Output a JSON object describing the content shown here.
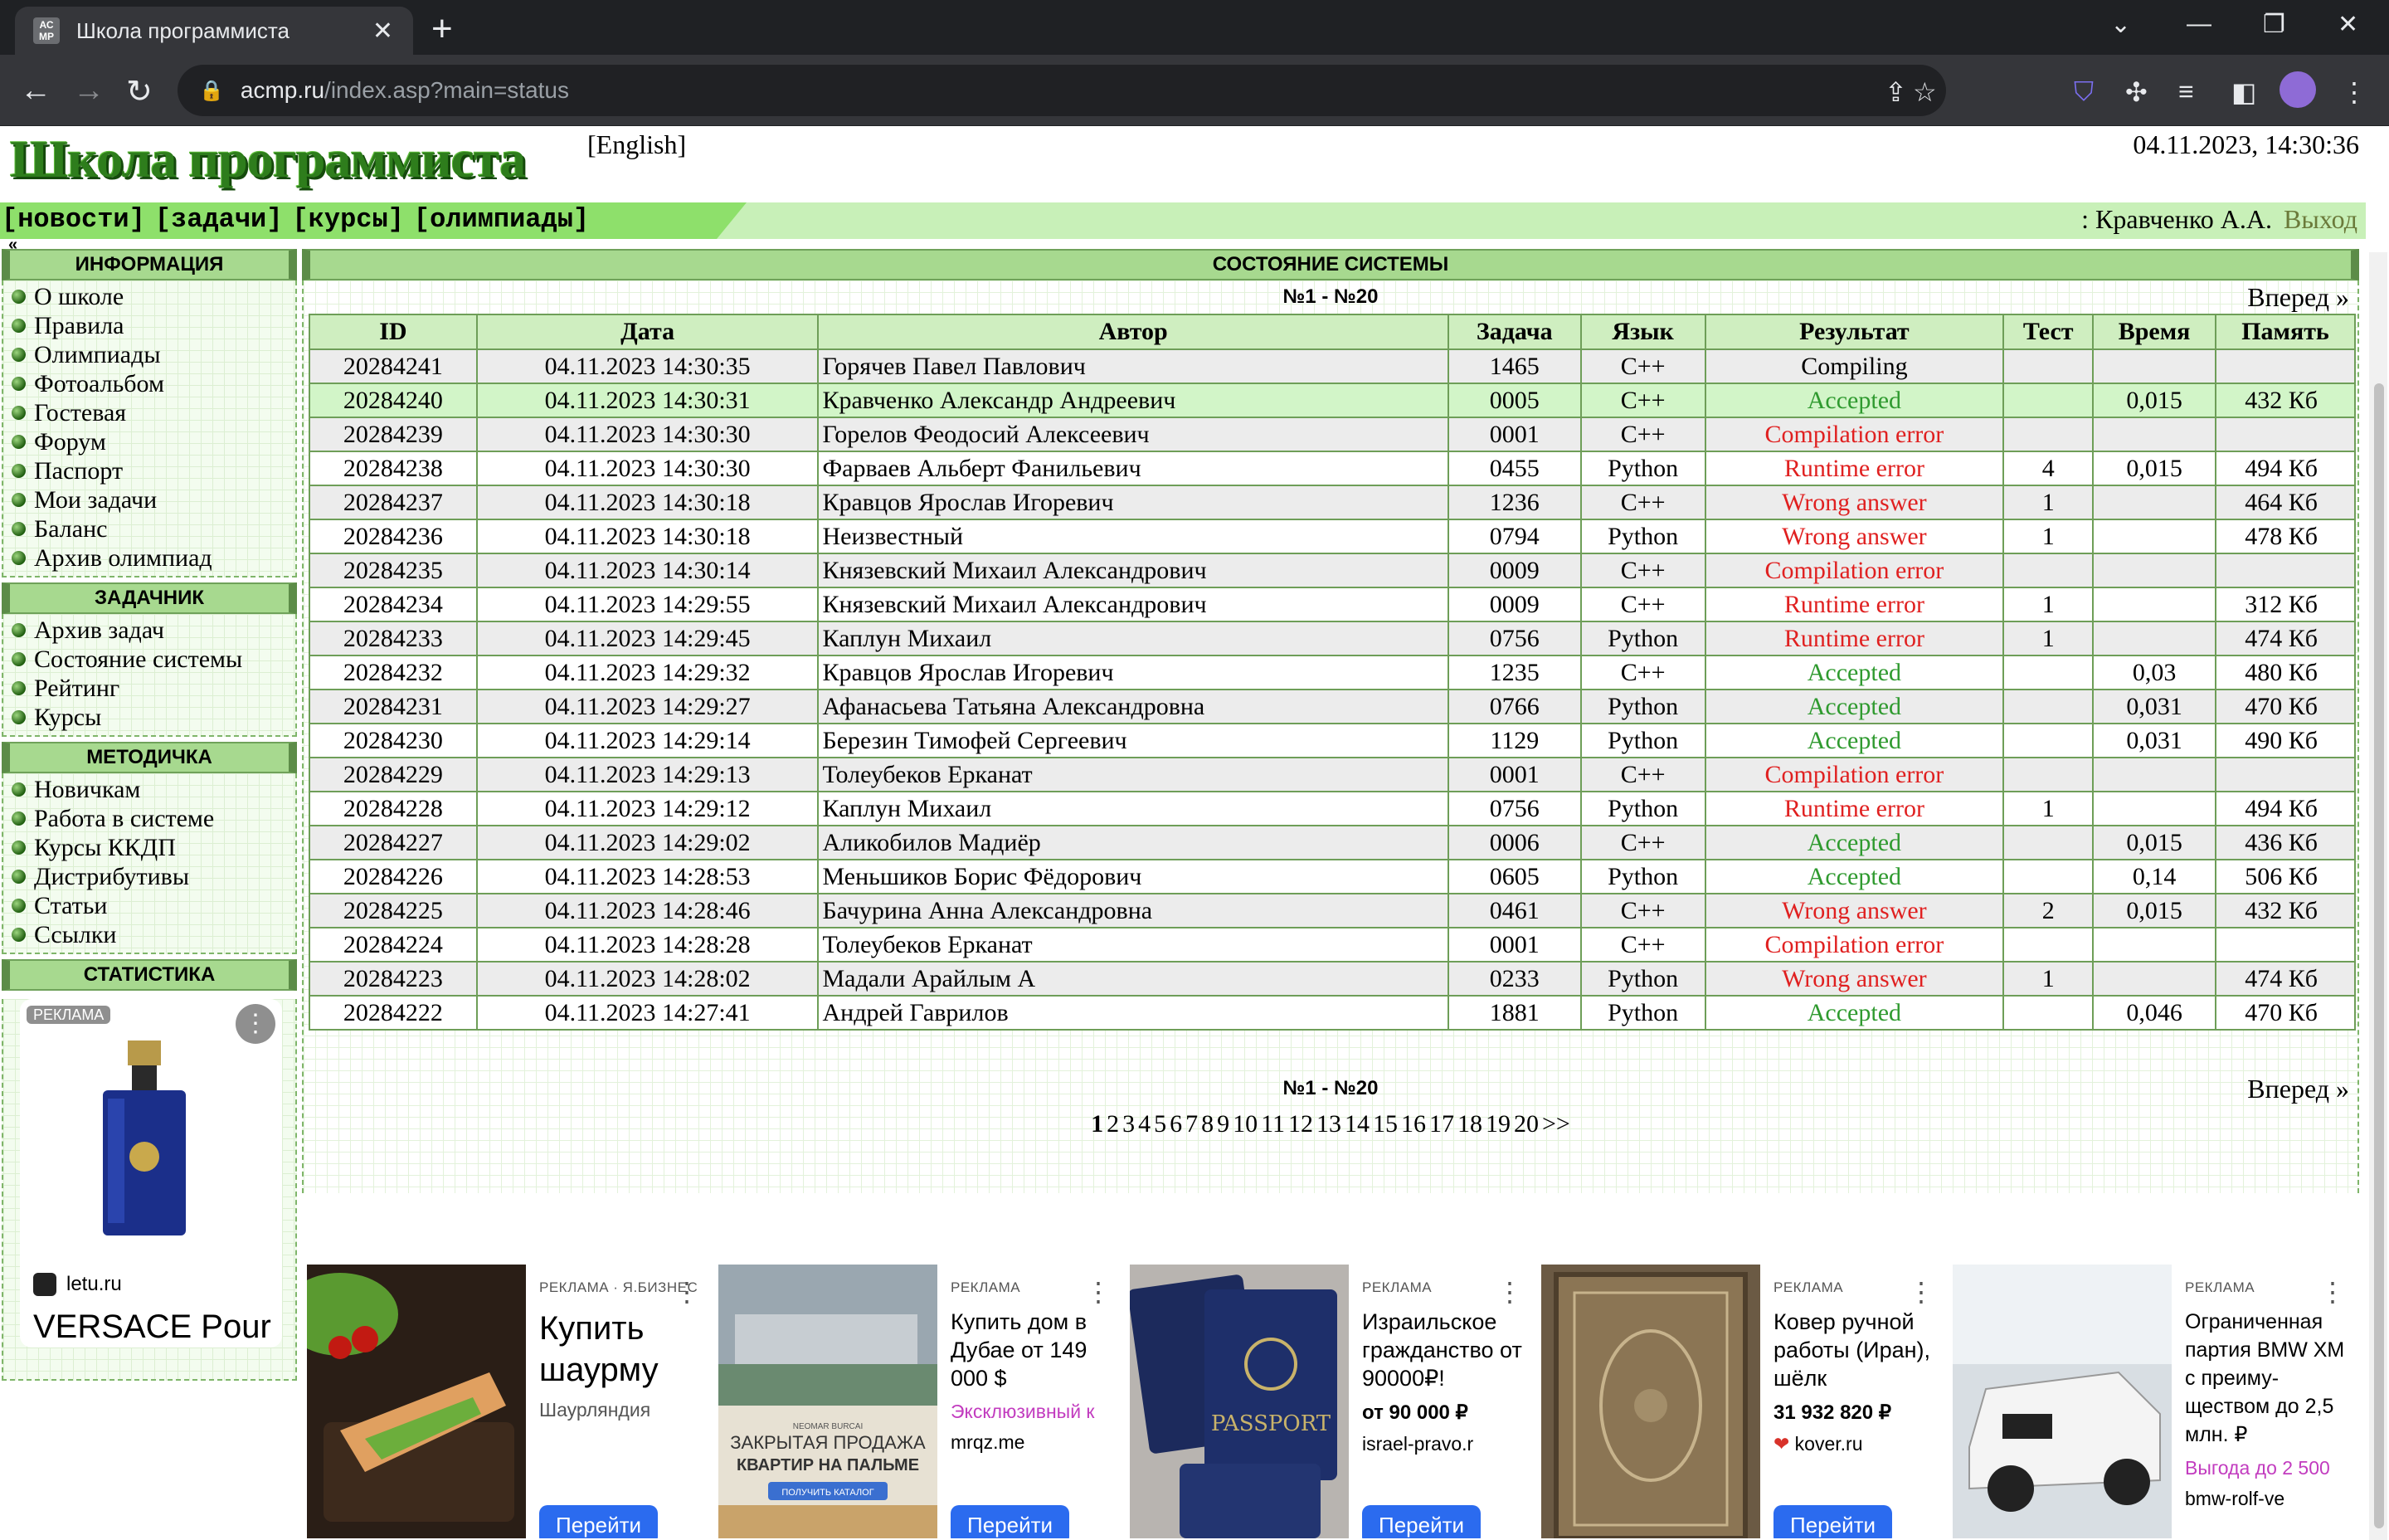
{
  "browser": {
    "tab_title": "Школа программиста",
    "favicon_text": "АС МР",
    "url_host": "acmp.ru",
    "url_path": "/index.asp?main=status"
  },
  "header": {
    "logo": "Школа программиста",
    "lang_link": "[English]",
    "datetime": "04.11.2023, 14:30:36"
  },
  "menu": {
    "items": [
      "[новости]",
      "[задачи]",
      "[курсы]",
      "[олимпиады]"
    ],
    "user_prefix": ": Кравченко А.А.",
    "logout": "Выход",
    "collapse": "«"
  },
  "sidebar": {
    "info_title": "ИНФОРМАЦИЯ",
    "info_items": [
      "О школе",
      "Правила",
      "Олимпиады",
      "Фотоальбом",
      "Гостевая",
      "Форум",
      "Паспорт",
      "Мои задачи",
      "Баланс",
      "Архив олимпиад"
    ],
    "tasks_title": "ЗАДАЧНИК",
    "tasks_items": [
      "Архив задач",
      "Состояние системы",
      "Рейтинг",
      "Курсы"
    ],
    "method_title": "МЕТОДИЧКА",
    "method_items": [
      "Новичкам",
      "Работа в системе",
      "Курсы ККДП",
      "Дистрибутивы",
      "Статьи",
      "Ссылки"
    ],
    "stats_title": "СТАТИСТИКА",
    "ad": {
      "tag": "РЕКЛАМА",
      "site": "letu.ru",
      "title": "VERSACE Pour Homme Dylan"
    }
  },
  "main": {
    "title": "СОСТОЯНИЕ СИСТЕМЫ",
    "range": "№1 - №20",
    "forward": "Вперед »",
    "columns": [
      "ID",
      "Дата",
      "Автор",
      "Задача",
      "Язык",
      "Результат",
      "Тест",
      "Время",
      "Память"
    ],
    "rows": [
      {
        "id": "20284241",
        "date": "04.11.2023 14:30:35",
        "author": "Горячев Павел Павлович",
        "task": "1465",
        "lang": "C++",
        "result": "Compiling",
        "status": "neutral",
        "test": "",
        "time": "",
        "mem": ""
      },
      {
        "id": "20284240",
        "date": "04.11.2023 14:30:31",
        "author": "Кравченко Александр Андреевич",
        "task": "0005",
        "lang": "C++",
        "result": "Accepted",
        "status": "ok",
        "test": "",
        "time": "0,015",
        "mem": "432 Кб",
        "mine": true
      },
      {
        "id": "20284239",
        "date": "04.11.2023 14:30:30",
        "author": "Горелов Феодосий Алексеевич",
        "task": "0001",
        "lang": "C++",
        "result": "Compilation error",
        "status": "err",
        "test": "",
        "time": "",
        "mem": ""
      },
      {
        "id": "20284238",
        "date": "04.11.2023 14:30:30",
        "author": "Фарваев Альберт Фанильевич",
        "task": "0455",
        "lang": "Python",
        "result": "Runtime error",
        "status": "err",
        "test": "4",
        "time": "0,015",
        "mem": "494 Кб"
      },
      {
        "id": "20284237",
        "date": "04.11.2023 14:30:18",
        "author": "Кравцов Ярослав Игоревич",
        "task": "1236",
        "lang": "C++",
        "result": "Wrong answer",
        "status": "err",
        "test": "1",
        "time": "",
        "mem": "464 Кб"
      },
      {
        "id": "20284236",
        "date": "04.11.2023 14:30:18",
        "author": "Неизвестный",
        "task": "0794",
        "lang": "Python",
        "result": "Wrong answer",
        "status": "err",
        "test": "1",
        "time": "",
        "mem": "478 Кб"
      },
      {
        "id": "20284235",
        "date": "04.11.2023 14:30:14",
        "author": "Князевский Михаил Александрович",
        "task": "0009",
        "lang": "C++",
        "result": "Compilation error",
        "status": "err",
        "test": "",
        "time": "",
        "mem": ""
      },
      {
        "id": "20284234",
        "date": "04.11.2023 14:29:55",
        "author": "Князевский Михаил Александрович",
        "task": "0009",
        "lang": "C++",
        "result": "Runtime error",
        "status": "err",
        "test": "1",
        "time": "",
        "mem": "312 Кб"
      },
      {
        "id": "20284233",
        "date": "04.11.2023 14:29:45",
        "author": "Каплун Михаил",
        "task": "0756",
        "lang": "Python",
        "result": "Runtime error",
        "status": "err",
        "test": "1",
        "time": "",
        "mem": "474 Кб"
      },
      {
        "id": "20284232",
        "date": "04.11.2023 14:29:32",
        "author": "Кравцов Ярослав Игоревич",
        "task": "1235",
        "lang": "C++",
        "result": "Accepted",
        "status": "ok",
        "test": "",
        "time": "0,03",
        "mem": "480 Кб"
      },
      {
        "id": "20284231",
        "date": "04.11.2023 14:29:27",
        "author": "Афанасьева Татьяна Александровна",
        "task": "0766",
        "lang": "Python",
        "result": "Accepted",
        "status": "ok",
        "test": "",
        "time": "0,031",
        "mem": "470 Кб"
      },
      {
        "id": "20284230",
        "date": "04.11.2023 14:29:14",
        "author": "Березин Тимофей Сергеевич",
        "task": "1129",
        "lang": "Python",
        "result": "Accepted",
        "status": "ok",
        "test": "",
        "time": "0,031",
        "mem": "490 Кб"
      },
      {
        "id": "20284229",
        "date": "04.11.2023 14:29:13",
        "author": "Толеубеков Ерканат",
        "task": "0001",
        "lang": "C++",
        "result": "Compilation error",
        "status": "err",
        "test": "",
        "time": "",
        "mem": ""
      },
      {
        "id": "20284228",
        "date": "04.11.2023 14:29:12",
        "author": "Каплун Михаил",
        "task": "0756",
        "lang": "Python",
        "result": "Runtime error",
        "status": "err",
        "test": "1",
        "time": "",
        "mem": "494 Кб"
      },
      {
        "id": "20284227",
        "date": "04.11.2023 14:29:02",
        "author": "Аликобилов Мадиёр",
        "task": "0006",
        "lang": "C++",
        "result": "Accepted",
        "status": "ok",
        "test": "",
        "time": "0,015",
        "mem": "436 Кб"
      },
      {
        "id": "20284226",
        "date": "04.11.2023 14:28:53",
        "author": "Меньшиков Борис Фёдорович",
        "task": "0605",
        "lang": "Python",
        "result": "Accepted",
        "status": "ok",
        "test": "",
        "time": "0,14",
        "mem": "506 Кб"
      },
      {
        "id": "20284225",
        "date": "04.11.2023 14:28:46",
        "author": "Бачурина Анна Александровна",
        "task": "0461",
        "lang": "C++",
        "result": "Wrong answer",
        "status": "err",
        "test": "2",
        "time": "0,015",
        "mem": "432 Кб"
      },
      {
        "id": "20284224",
        "date": "04.11.2023 14:28:28",
        "author": "Толеубеков Ерканат",
        "task": "0001",
        "lang": "C++",
        "result": "Compilation error",
        "status": "err",
        "test": "",
        "time": "",
        "mem": ""
      },
      {
        "id": "20284223",
        "date": "04.11.2023 14:28:02",
        "author": "Мадали Арайлым А",
        "task": "0233",
        "lang": "Python",
        "result": "Wrong answer",
        "status": "err",
        "test": "1",
        "time": "",
        "mem": "474 Кб"
      },
      {
        "id": "20284222",
        "date": "04.11.2023 14:27:41",
        "author": "Андрей Гаврилов",
        "task": "1881",
        "lang": "Python",
        "result": "Accepted",
        "status": "ok",
        "test": "",
        "time": "0,046",
        "mem": "470 Кб"
      }
    ],
    "pages": [
      "1",
      "2",
      "3",
      "4",
      "5",
      "6",
      "7",
      "8",
      "9",
      "10",
      "11",
      "12",
      "13",
      "14",
      "15",
      "16",
      "17",
      "18",
      "19",
      "20",
      ">>"
    ],
    "current_page": "1"
  },
  "ads": [
    {
      "tag": "РЕКЛАМА · Я.БИЗНЕС",
      "title": "Купить шаурму",
      "sub": "Шаурляндия",
      "button": "Перейти",
      "menu": "⋮"
    },
    {
      "tag": "РЕКЛАМА",
      "title": "Купить дом в Дубае от 149 000 $",
      "sub": "Эксклюзивный к",
      "site": "mrqz.me",
      "button": "Перейти",
      "menu": "⋮",
      "img_text": "ЗАКРЫТАЯ ПРОДАЖА КВАРТИР НА ПАЛЬМЕ",
      "img_btn": "ПОЛУЧИТЬ КАТАЛОГ"
    },
    {
      "tag": "РЕКЛАМА",
      "title": "Израильское гражданство от 90000₽!",
      "price": "от 90 000 ₽",
      "site": "israel-pravo.r",
      "button": "Перейти",
      "menu": "⋮"
    },
    {
      "tag": "РЕКЛАМА",
      "title": "Ковер ручной работы (Иран), шёлк",
      "price": "31 932 820 ₽",
      "site": "kover.ru",
      "button": "Перейти",
      "menu": "⋮"
    },
    {
      "tag": "РЕКЛАМА",
      "title": "Ограниченная партия BMW XM с преиму­ществом до 2,5 млн. ₽",
      "sub": "Выгода до 2 500",
      "site": "bmw-rolf-ve",
      "button": "Перейти",
      "menu": "⋮"
    }
  ],
  "colors": {
    "accepted": "#2f9a2f",
    "error": "#e02020",
    "header_green": "#a7d98f",
    "menu_green": "#8ee06b"
  }
}
